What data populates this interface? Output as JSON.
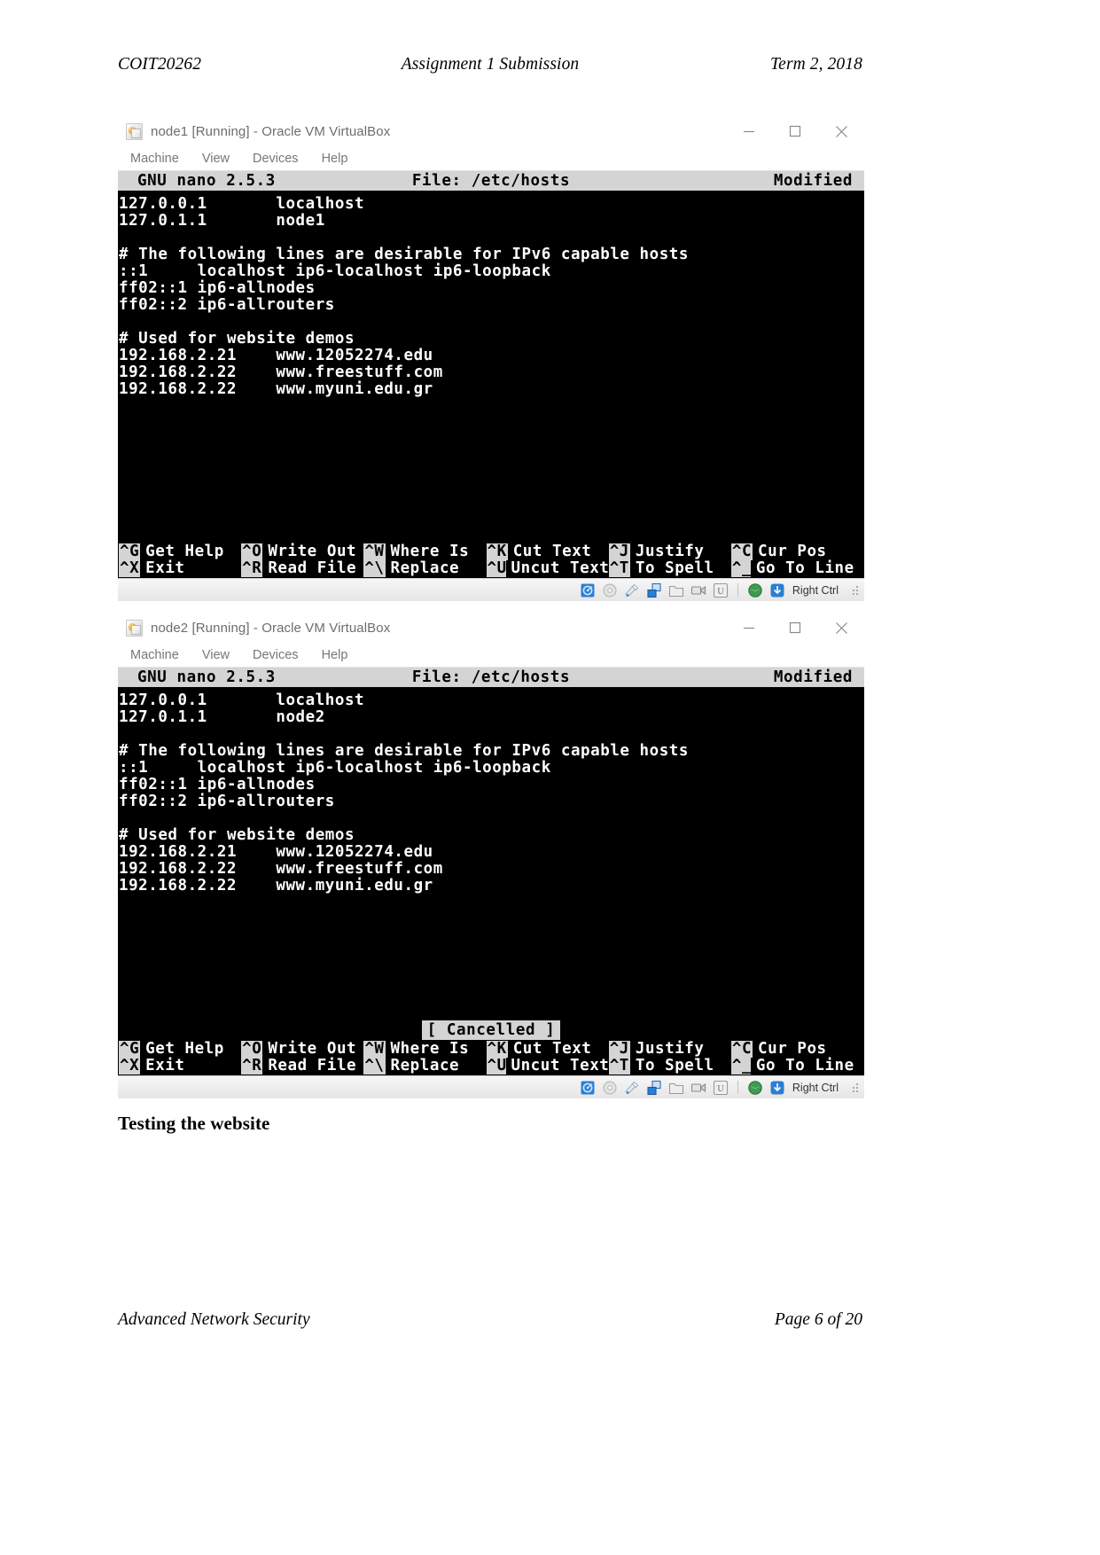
{
  "document": {
    "header": {
      "course_code": "COIT20262",
      "title": "Assignment 1 Submission",
      "term": "Term 2, 2018"
    },
    "footer": {
      "unit_name": "Advanced Network Security",
      "page_label": "Page 6 of 20"
    },
    "section_heading": "Testing the website"
  },
  "windows": [
    {
      "title": "node1 [Running] - Oracle VM VirtualBox",
      "menu": [
        "Machine",
        "View",
        "Devices",
        "Help"
      ],
      "window_buttons": [
        "minimize",
        "maximize",
        "close"
      ],
      "nano": {
        "version": "GNU nano 2.5.3",
        "file": "File: /etc/hosts",
        "modified": "Modified",
        "status_message": "",
        "lines": [
          "127.0.0.1       localhost",
          "127.0.1.1       node1",
          "",
          "# The following lines are desirable for IPv6 capable hosts",
          "::1     localhost ip6-localhost ip6-loopback",
          "ff02::1 ip6-allnodes",
          "ff02::2 ip6-allrouters",
          "",
          "# Used for website demos",
          "192.168.2.21    www.12052274.edu",
          "192.168.2.22    www.freestuff.com",
          "192.168.2.22    www.myuni.edu.gr"
        ],
        "shortcuts_row1": [
          {
            "key": "^G",
            "label": "Get Help"
          },
          {
            "key": "^O",
            "label": "Write Out"
          },
          {
            "key": "^W",
            "label": "Where Is"
          },
          {
            "key": "^K",
            "label": "Cut Text"
          },
          {
            "key": "^J",
            "label": "Justify"
          },
          {
            "key": "^C",
            "label": "Cur Pos"
          }
        ],
        "shortcuts_row2": [
          {
            "key": "^X",
            "label": "Exit"
          },
          {
            "key": "^R",
            "label": "Read File"
          },
          {
            "key": "^\\",
            "label": "Replace"
          },
          {
            "key": "^U",
            "label": "Uncut Text"
          },
          {
            "key": "^T",
            "label": "To Spell"
          },
          {
            "key": "^_",
            "label": "Go To Line"
          }
        ]
      },
      "statusbar": {
        "icons": [
          "hard-disk-icon",
          "optical-disk-icon",
          "usb-icon",
          "network-icon",
          "shared-folders-icon",
          "video-capture-icon",
          "virtualization-icon",
          "mouse-integration-icon",
          "host-key-icon"
        ],
        "host_key": "Right Ctrl"
      }
    },
    {
      "title": "node2 [Running] - Oracle VM VirtualBox",
      "menu": [
        "Machine",
        "View",
        "Devices",
        "Help"
      ],
      "window_buttons": [
        "minimize",
        "maximize",
        "close"
      ],
      "nano": {
        "version": "GNU nano 2.5.3",
        "file": "File: /etc/hosts",
        "modified": "Modified",
        "status_message": "[ Cancelled ]",
        "lines": [
          "127.0.0.1       localhost",
          "127.0.1.1       node2",
          "",
          "# The following lines are desirable for IPv6 capable hosts",
          "::1     localhost ip6-localhost ip6-loopback",
          "ff02::1 ip6-allnodes",
          "ff02::2 ip6-allrouters",
          "",
          "# Used for website demos",
          "192.168.2.21    www.12052274.edu",
          "192.168.2.22    www.freestuff.com",
          "192.168.2.22    www.myuni.edu.gr"
        ],
        "shortcuts_row1": [
          {
            "key": "^G",
            "label": "Get Help"
          },
          {
            "key": "^O",
            "label": "Write Out"
          },
          {
            "key": "^W",
            "label": "Where Is"
          },
          {
            "key": "^K",
            "label": "Cut Text"
          },
          {
            "key": "^J",
            "label": "Justify"
          },
          {
            "key": "^C",
            "label": "Cur Pos"
          }
        ],
        "shortcuts_row2": [
          {
            "key": "^X",
            "label": "Exit"
          },
          {
            "key": "^R",
            "label": "Read File"
          },
          {
            "key": "^\\",
            "label": "Replace"
          },
          {
            "key": "^U",
            "label": "Uncut Text"
          },
          {
            "key": "^T",
            "label": "To Spell"
          },
          {
            "key": "^_",
            "label": "Go To Line"
          }
        ]
      },
      "statusbar": {
        "icons": [
          "hard-disk-icon",
          "optical-disk-icon",
          "usb-icon",
          "network-icon",
          "shared-folders-icon",
          "video-capture-icon",
          "virtualization-icon",
          "mouse-integration-icon",
          "host-key-icon"
        ],
        "host_key": "Right Ctrl"
      }
    }
  ],
  "colors": {
    "terminal_bg": "#000000",
    "terminal_fg": "#ffffff",
    "nano_bar_bg": "#d4d4d4",
    "title_text": "#6d6d6d",
    "menu_text": "#777777"
  }
}
